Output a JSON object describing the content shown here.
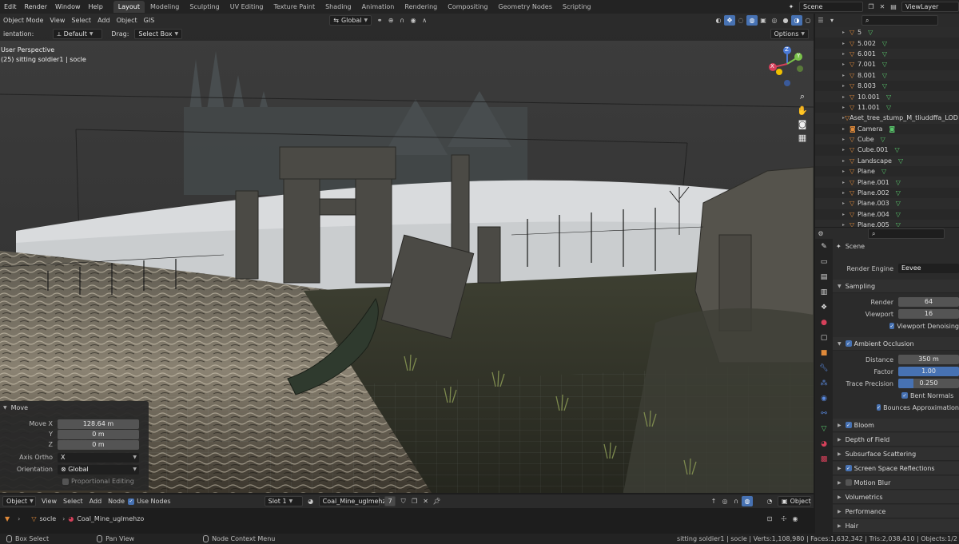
{
  "top_menu": [
    "Edit",
    "Render",
    "Window",
    "Help"
  ],
  "workspaces": [
    "Layout",
    "Modeling",
    "Sculpting",
    "UV Editing",
    "Texture Paint",
    "Shading",
    "Animation",
    "Rendering",
    "Compositing",
    "Geometry Nodes",
    "Scripting"
  ],
  "active_workspace": "Layout",
  "scene_name": "Scene",
  "view_layer": "ViewLayer",
  "viewport_header": {
    "mode": "Object Mode",
    "menus": [
      "View",
      "Select",
      "Add",
      "Object",
      "GIS"
    ],
    "transform": "Global"
  },
  "tool_settings": {
    "orientation_label": "ientation:",
    "orientation_value": "Default",
    "drag_label": "Drag:",
    "drag_value": "Select Box",
    "options": "Options"
  },
  "viewport_info": {
    "perspective": "User Perspective",
    "object": "(25) sitting soldier1 | socle"
  },
  "gizmo": {
    "z": "Z",
    "y": "Y",
    "x": "X"
  },
  "move_panel": {
    "title": "Move",
    "move_x_label": "Move X",
    "move_x": "128.64 m",
    "y_label": "Y",
    "y": "0 m",
    "z_label": "Z",
    "z": "0 m",
    "axis_ortho_label": "Axis Ortho",
    "axis_ortho": "X",
    "orientation_label": "Orientation",
    "orientation": "Global",
    "proportional": "Proportional Editing"
  },
  "outliner": [
    {
      "name": "5",
      "icon": "mesh"
    },
    {
      "name": "5.002",
      "icon": "mesh"
    },
    {
      "name": "6.001",
      "icon": "mesh"
    },
    {
      "name": "7.001",
      "icon": "mesh"
    },
    {
      "name": "8.001",
      "icon": "mesh"
    },
    {
      "name": "8.003",
      "icon": "mesh"
    },
    {
      "name": "10.001",
      "icon": "mesh"
    },
    {
      "name": "11.001",
      "icon": "mesh"
    },
    {
      "name": "Aset_tree_stump_M_tliuddffa_LOD",
      "icon": "mesh"
    },
    {
      "name": "Camera",
      "icon": "camera"
    },
    {
      "name": "Cube",
      "icon": "mesh"
    },
    {
      "name": "Cube.001",
      "icon": "mesh"
    },
    {
      "name": "Landscape",
      "icon": "mesh"
    },
    {
      "name": "Plane",
      "icon": "mesh"
    },
    {
      "name": "Plane.001",
      "icon": "mesh"
    },
    {
      "name": "Plane.002",
      "icon": "mesh"
    },
    {
      "name": "Plane.003",
      "icon": "mesh"
    },
    {
      "name": "Plane.004",
      "icon": "mesh"
    },
    {
      "name": "Plane.005",
      "icon": "mesh"
    }
  ],
  "properties": {
    "scene": "Scene",
    "render_engine_label": "Render Engine",
    "render_engine": "Eevee",
    "sampling": {
      "title": "Sampling",
      "render_label": "Render",
      "render": "64",
      "viewport_label": "Viewport",
      "viewport": "16",
      "denoise": "Viewport Denoising"
    },
    "ao": {
      "title": "Ambient Occlusion",
      "distance_label": "Distance",
      "distance": "350 m",
      "factor_label": "Factor",
      "factor": "1.00",
      "factor_fill": 1.0,
      "trace_label": "Trace Precision",
      "trace": "0.250",
      "trace_fill": 0.25,
      "bent_normals": "Bent Normals",
      "bounces": "Bounces Approximation"
    },
    "sections": [
      {
        "name": "Bloom",
        "checkbox": true,
        "checked": true
      },
      {
        "name": "Depth of Field",
        "checkbox": false
      },
      {
        "name": "Subsurface Scattering",
        "checkbox": false
      },
      {
        "name": "Screen Space Reflections",
        "checkbox": true,
        "checked": true
      },
      {
        "name": "Motion Blur",
        "checkbox": true,
        "checked": false
      },
      {
        "name": "Volumetrics",
        "checkbox": false
      },
      {
        "name": "Performance",
        "checkbox": false
      },
      {
        "name": "Hair",
        "checkbox": false
      }
    ]
  },
  "node_header": {
    "mode": "Object",
    "menus": [
      "View",
      "Select",
      "Add",
      "Node"
    ],
    "use_nodes": "Use Nodes",
    "slot": "Slot 1",
    "material": "Coal_Mine_uglmehzo",
    "users": "7",
    "right_mode": "Object"
  },
  "node_breadcrumb": {
    "object": "socle",
    "material": "Coal_Mine_uglmehzo"
  },
  "status": {
    "box_select": "Box Select",
    "pan_view": "Pan View",
    "node_context": "Node Context Menu",
    "stats": "sitting soldier1 | socle | Verts:1,108,980 | Faces:1,632,342 | Tris:2,038,410 | Objects:1/2"
  },
  "colors": {
    "accent": "#4772b3",
    "mesh_icon": "#e08a3a",
    "data_icon": "#58c56b"
  }
}
